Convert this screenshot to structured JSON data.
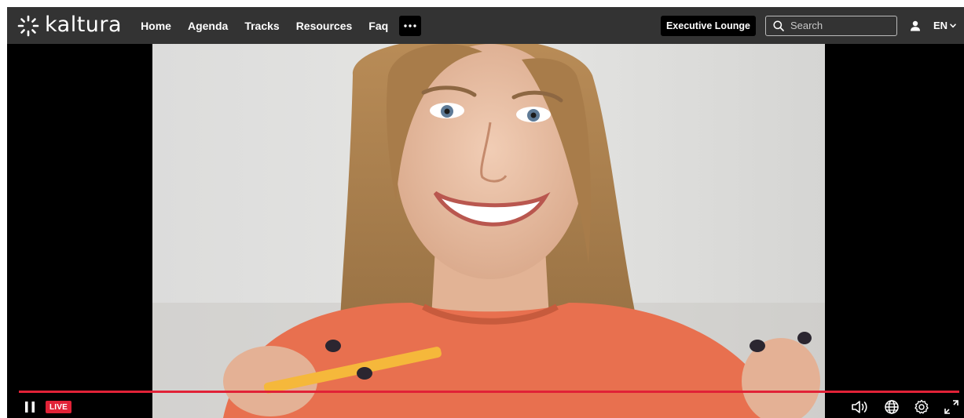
{
  "brand": {
    "name": "kaltura"
  },
  "nav": {
    "links": [
      "Home",
      "Agenda",
      "Tracks",
      "Resources",
      "Faq"
    ],
    "more_icon": "ellipsis-icon"
  },
  "header": {
    "lounge_label": "Executive Lounge",
    "search_placeholder": "Search",
    "user_icon": "user-icon",
    "language": "EN"
  },
  "player": {
    "state": "playing",
    "live_label": "LIVE",
    "progress_percent": 100,
    "controls": [
      "volume-icon",
      "globe-icon",
      "settings-icon",
      "fullscreen-icon"
    ]
  },
  "colors": {
    "navbar": "#333333",
    "accent_red": "#e12237",
    "button_bg": "#000000"
  }
}
